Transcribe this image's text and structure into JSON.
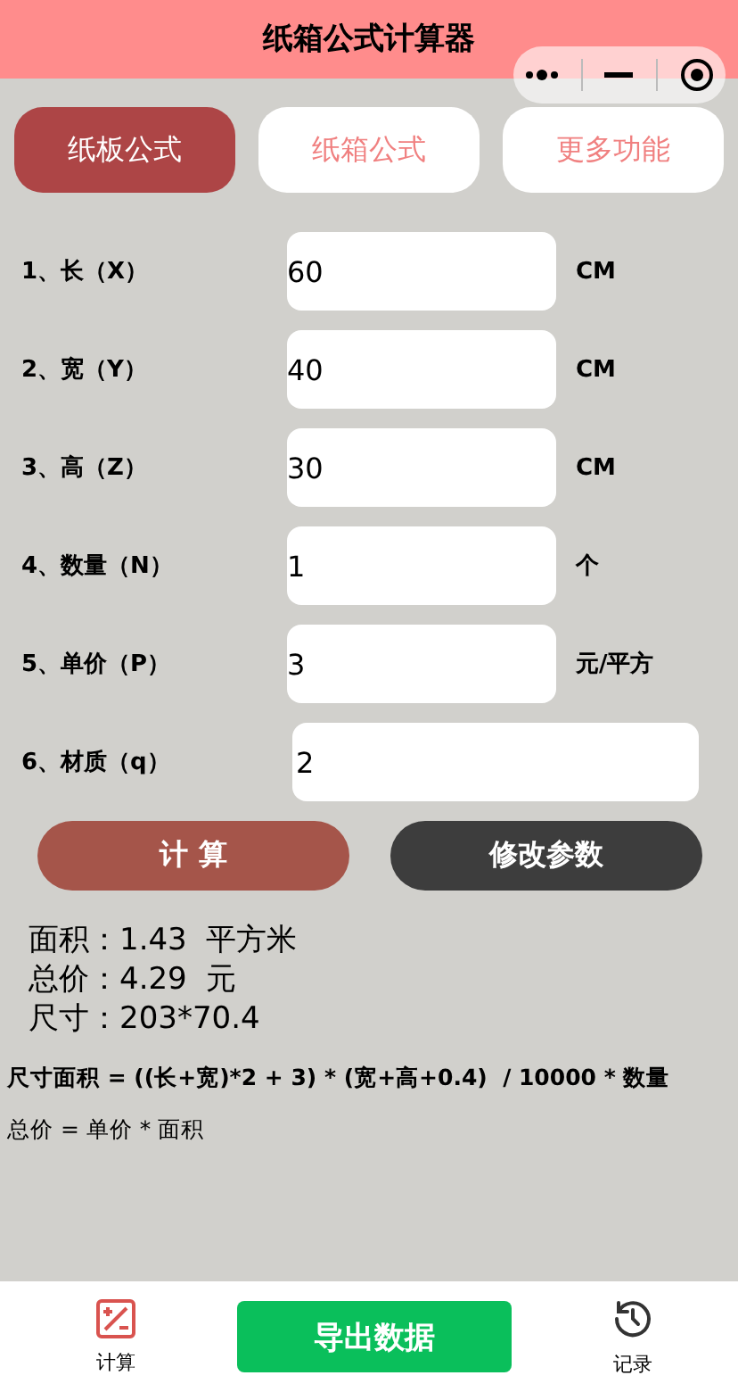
{
  "header": {
    "title": "纸箱公式计算器"
  },
  "tabs": [
    {
      "label": "纸板公式",
      "selected": true
    },
    {
      "label": "纸箱公式",
      "selected": false
    },
    {
      "label": "更多功能",
      "selected": false
    }
  ],
  "params": [
    {
      "label": "1、长（X）",
      "value": "60",
      "unit": "CM",
      "kind": "short"
    },
    {
      "label": "2、宽（Y）",
      "value": "40",
      "unit": "CM",
      "kind": "short"
    },
    {
      "label": "3、高（Z）",
      "value": "30",
      "unit": "CM",
      "kind": "short"
    },
    {
      "label": "4、数量（N）",
      "value": "1",
      "unit": "个",
      "kind": "short"
    },
    {
      "label": "5、单价（P）",
      "value": "3",
      "unit": "元/平方",
      "kind": "short"
    },
    {
      "label": "6、材质（q）",
      "value": "2",
      "kind": "wide"
    }
  ],
  "actions": [
    {
      "label": "计 算",
      "kind": "primary"
    },
    {
      "label": "修改参数",
      "kind": "secondary"
    }
  ],
  "results": [
    "面积：1.43  平方米",
    "总价：4.29  元",
    "尺寸：203*70.4"
  ],
  "formulas": [
    {
      "text": "尺寸面积 = ((长+宽)*2 + 3) * (宽+高+0.4)  / 10000 * 数量",
      "bold": true
    },
    {
      "text": "总价 = 单价 * 面积",
      "bold": false
    }
  ],
  "bottom_nav": [
    {
      "kind": "calculator",
      "label": "计算",
      "selected": true
    },
    {
      "kind": "button",
      "label": "导出数据"
    },
    {
      "kind": "history",
      "label": "记录",
      "selected": false
    }
  ]
}
